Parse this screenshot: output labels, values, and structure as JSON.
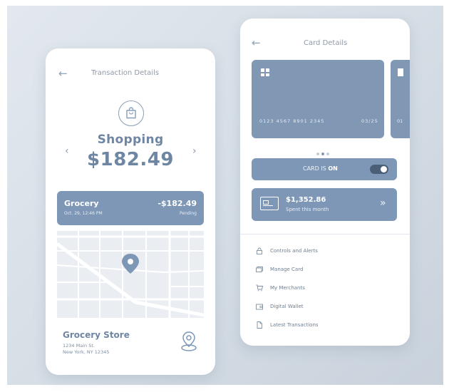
{
  "left_screen": {
    "title": "Transaction Details",
    "back_icon": "arrow-left-icon",
    "category_icon": "shopping-bag-icon",
    "category": "Shopping",
    "amount": "$182.49",
    "prev_icon": "chevron-left-icon",
    "next_icon": "chevron-right-icon",
    "transaction": {
      "name": "Grocery",
      "date": "Oct. 29, 12:46 PM",
      "amount": "-$182.49",
      "status": "Pending"
    },
    "store": {
      "name": "Grocery Store",
      "address_line1": "1234 Main St.",
      "address_line2": "New York, NY 12345",
      "pin_icon": "location-pin-icon"
    }
  },
  "right_screen": {
    "title": "Card Details",
    "back_icon": "arrow-left-icon",
    "card": {
      "number": "0123 4567 8901 2345",
      "expiry": "03/25",
      "peek_number": "01"
    },
    "pagination": {
      "count": 3,
      "active": 1
    },
    "toggle": {
      "label_prefix": "CARD IS ",
      "state": "ON",
      "on": true
    },
    "spent": {
      "amount": "$1,352.86",
      "label": "Spent this month",
      "arrow_icon": "double-chevron-right-icon"
    },
    "menu": [
      {
        "label": "Controls and Alerts",
        "icon": "lock-icon"
      },
      {
        "label": "Manage Card",
        "icon": "cards-icon"
      },
      {
        "label": "My Merchants",
        "icon": "cart-icon"
      },
      {
        "label": "Digital Wallet",
        "icon": "wallet-icon"
      },
      {
        "label": "Latest Transactions",
        "icon": "document-icon"
      }
    ]
  },
  "colors": {
    "accent": "#7e97b6",
    "text_accent": "#6f86a3",
    "background": "#d6dee6",
    "toggle_dark": "#4a5e78"
  }
}
